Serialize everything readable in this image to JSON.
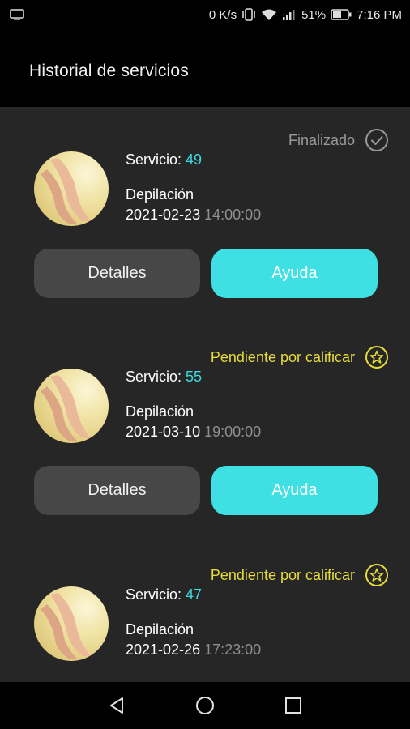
{
  "status_bar": {
    "network_speed": "0 K/s",
    "battery": "51%",
    "time": "7:16 PM",
    "icons": [
      "screen-cast-icon",
      "vibrate-icon",
      "wifi-icon",
      "signal-icon",
      "battery-icon"
    ]
  },
  "header": {
    "title": "Historial de servicios"
  },
  "labels": {
    "service_prefix": "Servicio:",
    "details_button": "Detalles",
    "help_button": "Ayuda"
  },
  "services": [
    {
      "status": "Finalizado",
      "status_icon": "check-circle-icon",
      "number": "49",
      "type": "Depilación",
      "date": "2021-02-23",
      "time": "14:00:00"
    },
    {
      "status": "Pendiente por calificar",
      "status_icon": "star-circle-icon",
      "number": "55",
      "type": "Depilación",
      "date": "2021-03-10",
      "time": "19:00:00"
    },
    {
      "status": "Pendiente por calificar",
      "status_icon": "star-circle-icon",
      "number": "47",
      "type": "Depilación",
      "date": "2021-02-26",
      "time": "17:23:00"
    }
  ],
  "colors": {
    "accent": "#3fe0e4",
    "pending": "#e6dc3a",
    "background": "#262626"
  },
  "nav": {
    "icons": [
      "back-icon",
      "home-icon",
      "recents-icon"
    ]
  }
}
